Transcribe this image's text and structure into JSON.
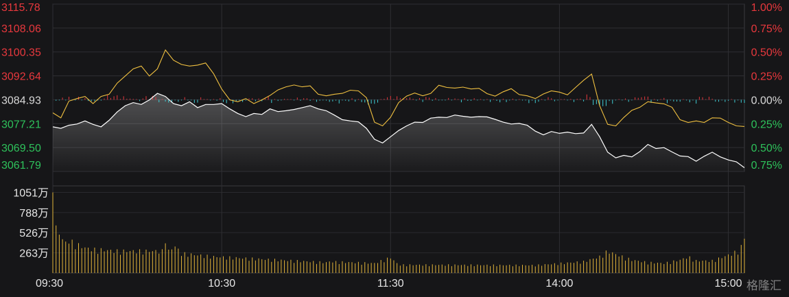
{
  "chart_data": {
    "type": "line",
    "price_panel": {
      "ylim": [
        3061.79,
        3115.78
      ],
      "base_price": 3084.93,
      "y_tick_labels": [
        "3115.78",
        "3108.06",
        "3100.35",
        "3092.64",
        "3084.93",
        "3077.21",
        "3069.50",
        "3061.79"
      ],
      "y_tick_values": [
        3115.78,
        3108.06,
        3100.35,
        3092.64,
        3084.93,
        3077.21,
        3069.5,
        3061.79
      ],
      "pct_tick_labels": [
        "1.00%",
        "0.75%",
        "0.50%",
        "0.25%",
        "0.00%",
        "0.25%",
        "0.50%",
        "0.75%"
      ],
      "series": [
        {
          "key": "price",
          "color": "#ffffff",
          "points": [
            [
              0,
              3076.2
            ],
            [
              5,
              3075.7
            ],
            [
              10,
              3076.7
            ],
            [
              15,
              3077.1
            ],
            [
              20,
              3078.1
            ],
            [
              25,
              3077.0
            ],
            [
              30,
              3076.2
            ],
            [
              35,
              3078.3
            ],
            [
              40,
              3081.0
            ],
            [
              45,
              3083.0
            ],
            [
              50,
              3084.0
            ],
            [
              55,
              3083.4
            ],
            [
              60,
              3084.9
            ],
            [
              65,
              3087.0
            ],
            [
              70,
              3086.0
            ],
            [
              75,
              3083.7
            ],
            [
              80,
              3083.0
            ],
            [
              85,
              3084.3
            ],
            [
              90,
              3082.4
            ],
            [
              95,
              3083.4
            ],
            [
              100,
              3083.4
            ],
            [
              105,
              3083.7
            ],
            [
              110,
              3082.0
            ],
            [
              115,
              3080.5
            ],
            [
              120,
              3079.5
            ],
            [
              125,
              3080.5
            ],
            [
              130,
              3080.2
            ],
            [
              135,
              3082.0
            ],
            [
              140,
              3081.1
            ],
            [
              145,
              3081.4
            ],
            [
              150,
              3081.8
            ],
            [
              155,
              3082.4
            ],
            [
              160,
              3083.0
            ],
            [
              165,
              3082.0
            ],
            [
              170,
              3081.4
            ],
            [
              175,
              3080.0
            ],
            [
              180,
              3078.5
            ],
            [
              185,
              3078.1
            ],
            [
              190,
              3077.8
            ],
            [
              195,
              3075.7
            ],
            [
              200,
              3072.2
            ],
            [
              205,
              3071.0
            ],
            [
              210,
              3073.0
            ],
            [
              215,
              3075.0
            ],
            [
              220,
              3076.5
            ],
            [
              225,
              3077.7
            ],
            [
              230,
              3077.6
            ],
            [
              235,
              3079.0
            ],
            [
              240,
              3079.3
            ],
            [
              245,
              3079.2
            ],
            [
              250,
              3080.0
            ],
            [
              255,
              3079.6
            ],
            [
              260,
              3079.3
            ],
            [
              265,
              3079.5
            ],
            [
              270,
              3079.4
            ],
            [
              275,
              3078.6
            ],
            [
              280,
              3077.7
            ],
            [
              285,
              3077.1
            ],
            [
              290,
              3077.3
            ],
            [
              295,
              3076.7
            ],
            [
              300,
              3074.8
            ],
            [
              305,
              3073.6
            ],
            [
              310,
              3074.7
            ],
            [
              315,
              3074.1
            ],
            [
              320,
              3074.5
            ],
            [
              325,
              3074.0
            ],
            [
              330,
              3074.2
            ],
            [
              335,
              3077.0
            ],
            [
              340,
              3073.0
            ],
            [
              345,
              3068.0
            ],
            [
              350,
              3066.2
            ],
            [
              355,
              3067.0
            ],
            [
              360,
              3066.5
            ],
            [
              365,
              3068.2
            ],
            [
              370,
              3070.5
            ],
            [
              375,
              3069.2
            ],
            [
              380,
              3069.5
            ],
            [
              385,
              3068.1
            ],
            [
              390,
              3066.8
            ],
            [
              395,
              3066.6
            ],
            [
              400,
              3065.1
            ],
            [
              405,
              3066.7
            ],
            [
              410,
              3068.0
            ],
            [
              415,
              3066.5
            ],
            [
              420,
              3065.5
            ],
            [
              425,
              3064.9
            ],
            [
              430,
              3063.0
            ]
          ]
        },
        {
          "key": "average",
          "color": "#f0c040",
          "points": [
            [
              0,
              3080.7
            ],
            [
              5,
              3079.1
            ],
            [
              10,
              3084.5
            ],
            [
              15,
              3085.3
            ],
            [
              20,
              3086.0
            ],
            [
              25,
              3083.7
            ],
            [
              30,
              3086.0
            ],
            [
              35,
              3086.7
            ],
            [
              40,
              3090.3
            ],
            [
              45,
              3092.6
            ],
            [
              50,
              3094.9
            ],
            [
              55,
              3095.8
            ],
            [
              60,
              3092.6
            ],
            [
              65,
              3094.9
            ],
            [
              70,
              3101.0
            ],
            [
              75,
              3097.7
            ],
            [
              80,
              3096.3
            ],
            [
              85,
              3095.8
            ],
            [
              90,
              3096.1
            ],
            [
              95,
              3096.8
            ],
            [
              100,
              3093.3
            ],
            [
              105,
              3088.4
            ],
            [
              110,
              3084.9
            ],
            [
              115,
              3084.3
            ],
            [
              120,
              3085.3
            ],
            [
              125,
              3083.7
            ],
            [
              130,
              3084.9
            ],
            [
              135,
              3086.3
            ],
            [
              140,
              3088.1
            ],
            [
              145,
              3089.1
            ],
            [
              150,
              3089.7
            ],
            [
              155,
              3089.1
            ],
            [
              160,
              3089.4
            ],
            [
              165,
              3086.7
            ],
            [
              170,
              3086.2
            ],
            [
              175,
              3086.7
            ],
            [
              180,
              3087.0
            ],
            [
              185,
              3088.0
            ],
            [
              190,
              3087.8
            ],
            [
              195,
              3085.6
            ],
            [
              200,
              3077.7
            ],
            [
              205,
              3076.5
            ],
            [
              210,
              3079.3
            ],
            [
              215,
              3084.0
            ],
            [
              220,
              3086.1
            ],
            [
              225,
              3087.1
            ],
            [
              230,
              3086.2
            ],
            [
              235,
              3087.0
            ],
            [
              240,
              3089.6
            ],
            [
              245,
              3088.9
            ],
            [
              250,
              3088.7
            ],
            [
              255,
              3089.0
            ],
            [
              260,
              3088.4
            ],
            [
              265,
              3088.6
            ],
            [
              270,
              3086.9
            ],
            [
              275,
              3086.1
            ],
            [
              280,
              3087.5
            ],
            [
              285,
              3088.5
            ],
            [
              290,
              3086.6
            ],
            [
              295,
              3086.2
            ],
            [
              300,
              3085.3
            ],
            [
              305,
              3086.8
            ],
            [
              310,
              3087.8
            ],
            [
              315,
              3087.4
            ],
            [
              320,
              3086.5
            ],
            [
              325,
              3088.9
            ],
            [
              330,
              3091.2
            ],
            [
              335,
              3093.2
            ],
            [
              340,
              3083.0
            ],
            [
              345,
              3077.0
            ],
            [
              350,
              3076.5
            ],
            [
              355,
              3079.2
            ],
            [
              360,
              3081.5
            ],
            [
              365,
              3082.5
            ],
            [
              370,
              3084.3
            ],
            [
              375,
              3083.9
            ],
            [
              380,
              3083.6
            ],
            [
              385,
              3082.5
            ],
            [
              390,
              3078.5
            ],
            [
              395,
              3077.6
            ],
            [
              400,
              3078.1
            ],
            [
              405,
              3077.6
            ],
            [
              410,
              3079.1
            ],
            [
              415,
              3079.0
            ],
            [
              420,
              3077.6
            ],
            [
              425,
              3076.5
            ],
            [
              430,
              3076.3
            ]
          ]
        }
      ]
    },
    "volume_panel": {
      "ylim": [
        0,
        1100
      ],
      "y_tick_labels": [
        "1051万",
        "788万",
        "526万",
        "263万"
      ],
      "y_tick_values": [
        1051,
        788,
        526,
        263
      ],
      "anchors": [
        [
          0,
          1051
        ],
        [
          1,
          700
        ],
        [
          2,
          620
        ],
        [
          3,
          560
        ],
        [
          4,
          500
        ],
        [
          5,
          470
        ],
        [
          6,
          440
        ],
        [
          7,
          420
        ],
        [
          8,
          410
        ],
        [
          9,
          400
        ],
        [
          12,
          380
        ],
        [
          15,
          350
        ],
        [
          20,
          310
        ],
        [
          25,
          290
        ],
        [
          30,
          285
        ],
        [
          40,
          270
        ],
        [
          55,
          270
        ],
        [
          69,
          270
        ],
        [
          70,
          430
        ],
        [
          71,
          300
        ],
        [
          72,
          270
        ],
        [
          76,
          330
        ],
        [
          80,
          240
        ],
        [
          100,
          200
        ],
        [
          130,
          170
        ],
        [
          150,
          150
        ],
        [
          170,
          130
        ],
        [
          171,
          230
        ],
        [
          172,
          140
        ],
        [
          200,
          120
        ],
        [
          210,
          190
        ],
        [
          215,
          100
        ],
        [
          240,
          100
        ],
        [
          300,
          95
        ],
        [
          330,
          140
        ],
        [
          340,
          200
        ],
        [
          345,
          270
        ],
        [
          350,
          230
        ],
        [
          360,
          160
        ],
        [
          370,
          130
        ],
        [
          380,
          120
        ],
        [
          390,
          160
        ],
        [
          395,
          200
        ],
        [
          400,
          150
        ],
        [
          410,
          150
        ],
        [
          420,
          220
        ],
        [
          426,
          270
        ],
        [
          429,
          350
        ],
        [
          430,
          440
        ]
      ]
    },
    "x_tick_labels": [
      "09:30",
      "10:30",
      "11:30",
      "14:00",
      "15:00"
    ],
    "x_tick_values": [
      0,
      105,
      210,
      315,
      420
    ],
    "x_minutes_total": 430,
    "grid": true,
    "watermark": "格隆汇"
  }
}
